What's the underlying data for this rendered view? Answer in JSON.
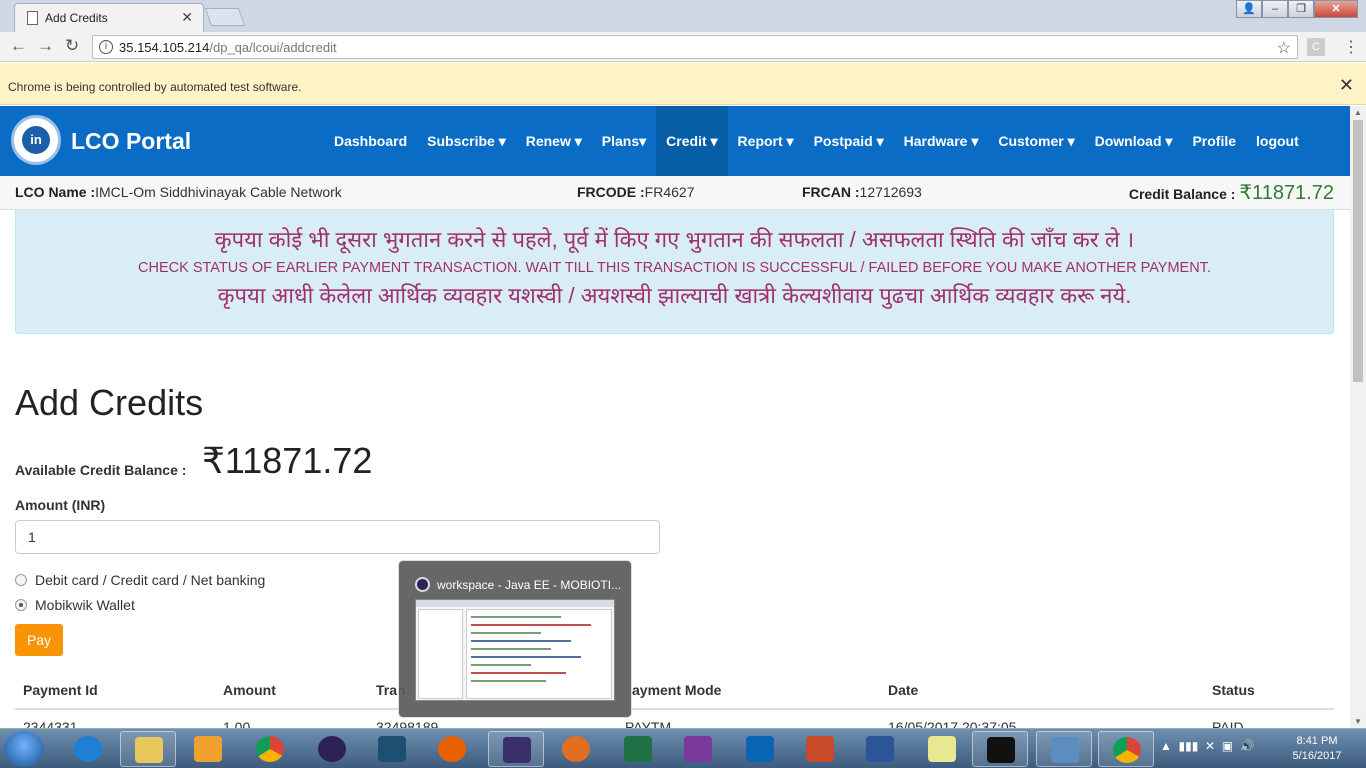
{
  "browser": {
    "tab_title": "Add Credits",
    "url_host": "35.154.105.214",
    "url_path": "/dp_qa/lcoui/addcredit",
    "infobar_text": "Chrome is being controlled by automated test software."
  },
  "navbar": {
    "brand": "LCO Portal",
    "logo_text": "in",
    "items": [
      {
        "label": "Dashboard"
      },
      {
        "label": "Subscribe ▾"
      },
      {
        "label": "Renew ▾"
      },
      {
        "label": "Plans▾"
      },
      {
        "label": "Credit ▾"
      },
      {
        "label": "Report ▾"
      },
      {
        "label": "Postpaid ▾"
      },
      {
        "label": "Hardware ▾"
      },
      {
        "label": "Customer ▾"
      },
      {
        "label": "Download ▾"
      },
      {
        "label": "Profile"
      },
      {
        "label": "logout"
      }
    ],
    "active_item": "Credit ▾"
  },
  "infoline": {
    "lco_name_label": "LCO Name :",
    "lco_name": "IMCL-Om Siddhivinayak Cable Network",
    "frcode_label": "FRCODE :",
    "frcode": "FR4627",
    "frcan_label": "FRCAN :",
    "frcan": "12712693",
    "credit_balance_label": "Credit Balance :",
    "credit_balance": "₹11871.72"
  },
  "alert": {
    "line1": "कृपया कोई भी दूसरा भुगतान करने से पहले, पूर्व में किए गए भुगतान की सफलता / असफलता स्थिति की जाँच कर ले ।",
    "line2": "CHECK STATUS OF EARLIER PAYMENT TRANSACTION. WAIT TILL THIS TRANSACTION IS SUCCESSFUL / FAILED BEFORE YOU MAKE ANOTHER PAYMENT.",
    "line3": "कृपया आधी केलेला आर्थिक व्यवहार यशस्वी / अयशस्वी झाल्याची खात्री केल्यशीवाय पुढचा आर्थिक व्यवहार करू नये."
  },
  "form": {
    "title": "Add Credits",
    "available_label": "Available Credit Balance :",
    "available_value": "₹11871.72",
    "amount_label": "Amount (INR)",
    "amount_value": "1",
    "option_card": "Debit card / Credit card / Net banking",
    "option_wallet": "Mobikwik Wallet",
    "selected_option": "Mobikwik Wallet",
    "pay_label": "Pay"
  },
  "table": {
    "headers": [
      "Payment Id",
      "Amount",
      "Tran",
      "ayment Mode",
      "Date",
      "Status"
    ],
    "rows": [
      [
        "2344331",
        "1.00",
        "32498189",
        "PAYTM",
        "16/05/2017 20:37:05",
        "PAID"
      ]
    ]
  },
  "thumbnail_popup": {
    "title": "workspace - Java EE - MOBIOTI..."
  },
  "taskbar": {
    "time": "8:41 PM",
    "date": "5/16/2017"
  }
}
